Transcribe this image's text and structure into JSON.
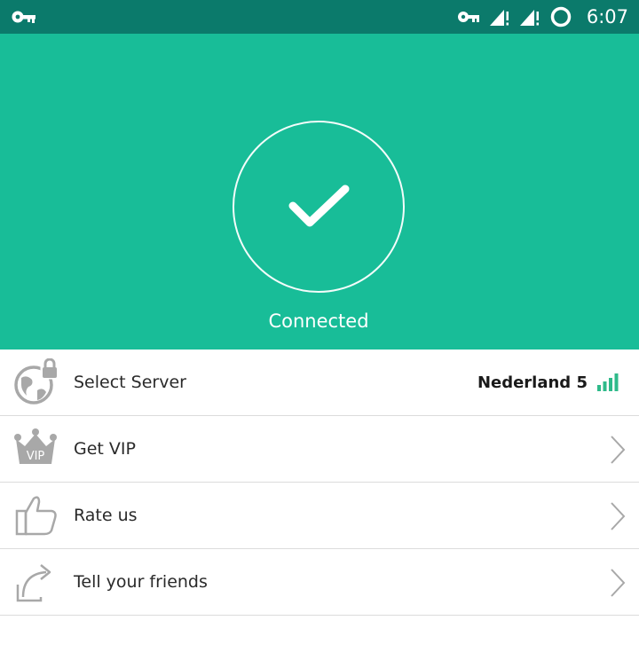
{
  "status_bar": {
    "time": "6:07",
    "icons": [
      "vpn-key-icon",
      "vpn-key-icon",
      "signal-no-data-icon",
      "signal-no-data-icon",
      "sync-ring-icon"
    ]
  },
  "hero": {
    "status_label": "Connected",
    "icon": "checkmark-icon",
    "background_color": "#18bd98"
  },
  "menu": {
    "items": [
      {
        "label": "Select Server",
        "icon": "globe-lock-icon",
        "value": "Nederland 5",
        "value_icon": "signal-bars-icon"
      },
      {
        "label": "Get VIP",
        "icon": "vip-crown-icon",
        "trailing_icon": "chevron-right-icon"
      },
      {
        "label": "Rate us",
        "icon": "thumbs-up-icon",
        "trailing_icon": "chevron-right-icon"
      },
      {
        "label": "Tell your friends",
        "icon": "share-arrow-icon",
        "trailing_icon": "chevron-right-icon"
      }
    ]
  },
  "colors": {
    "accent": "#18bd98",
    "status_bar": "#0b7a6b",
    "signal_green": "#2fba8a",
    "icon_gray": "#9e9e9e"
  }
}
